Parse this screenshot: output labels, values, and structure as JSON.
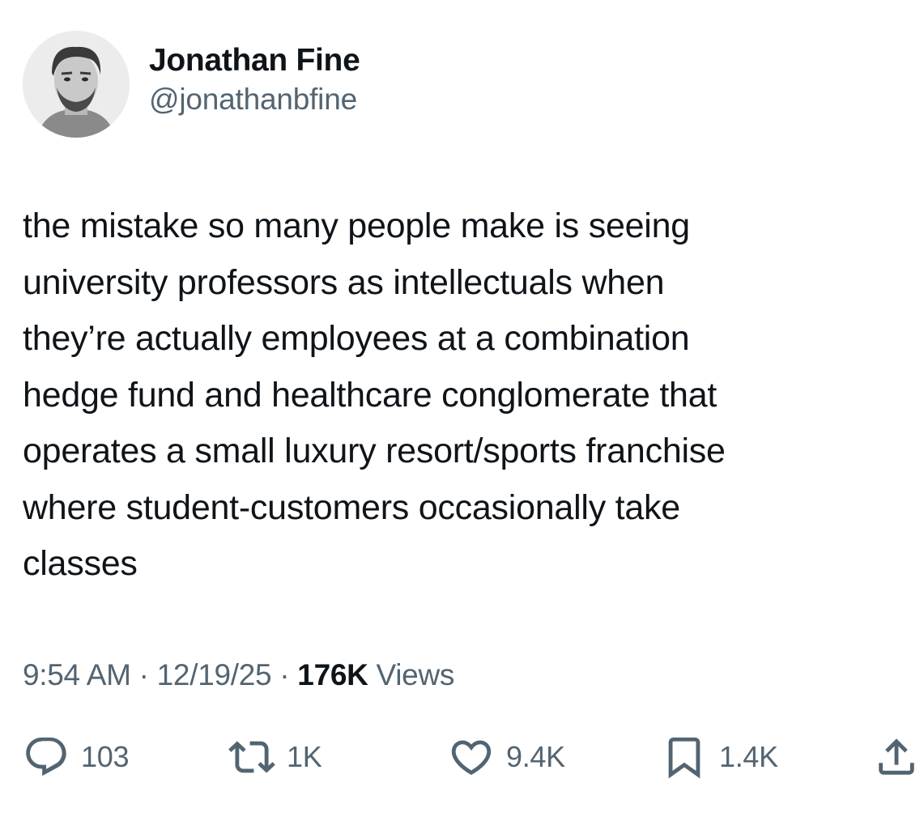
{
  "author": {
    "display_name": "Jonathan Fine",
    "handle": "@jonathanbfine"
  },
  "tweet": {
    "text": "the mistake so many people make is seeing\nuniversity professors as intellectuals when\nthey’re actually employees at a combination\nhedge fund and healthcare conglomerate that\noperates a small luxury resort/sports franchise\nwhere student-customers occasionally take\nclasses",
    "time": "9:54 AM",
    "separator": "·",
    "date": "12/19/25",
    "views_count": "176K",
    "views_label": "Views"
  },
  "actions": {
    "replies": {
      "icon": "reply-icon",
      "count": "103"
    },
    "reposts": {
      "icon": "repost-icon",
      "count": "1K"
    },
    "likes": {
      "icon": "heart-icon",
      "count": "9.4K"
    },
    "bookmarks": {
      "icon": "bookmark-icon",
      "count": "1.4K"
    },
    "share": {
      "icon": "share-icon"
    }
  },
  "colors": {
    "text_primary": "#0f1419",
    "text_secondary": "#536471",
    "background": "#ffffff"
  }
}
